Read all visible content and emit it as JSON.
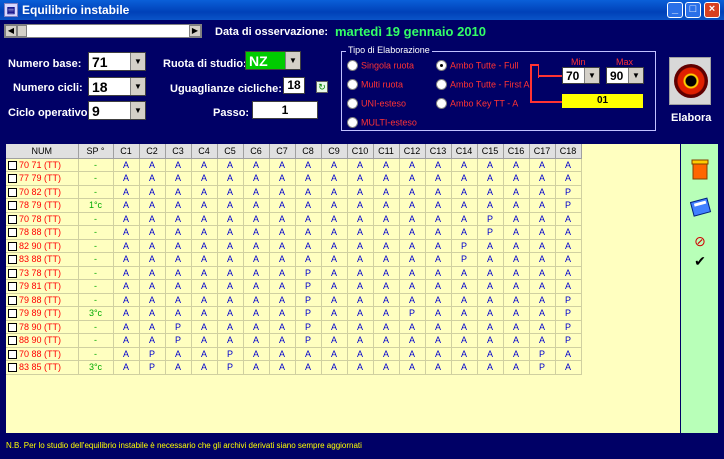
{
  "window": {
    "title": "Equilibrio instabile"
  },
  "header": {
    "obs_label": "Data di osservazione:",
    "obs_date": "martedì 19 gennaio 2010"
  },
  "form": {
    "numero_base_label": "Numero base:",
    "numero_base_value": "71",
    "numero_cicli_label": "Numero cicli:",
    "numero_cicli_value": "18",
    "ciclo_operativo_label": "Ciclo operativo:",
    "ciclo_operativo_value": "9",
    "ruota_label": "Ruota di studio:",
    "ruota_value": "NZ",
    "uguaglianze_label": "Uguaglianze cicliche:",
    "uguaglianze_value": "18",
    "passo_label": "Passo:",
    "passo_value": "1"
  },
  "elaborazione": {
    "title": "Tipo di Elaborazione",
    "options": [
      {
        "label": "Singola ruota",
        "selected": false
      },
      {
        "label": "Multi ruota",
        "selected": false
      },
      {
        "label": "UNI-esteso",
        "selected": false
      },
      {
        "label": "MULTI-esteso",
        "selected": false
      },
      {
        "label": "Ambo Tutte - Full",
        "selected": true
      },
      {
        "label": "Ambo Tutte - First A",
        "selected": false
      },
      {
        "label": "Ambo Key TT -  A",
        "selected": false
      }
    ],
    "min_label": "Min",
    "max_label": "Max",
    "min_value": "70",
    "max_value": "90",
    "result_value": "01"
  },
  "elabora": {
    "label": "Elabora"
  },
  "table": {
    "headers": [
      "NUM",
      "SP °",
      "C1",
      "C2",
      "C3",
      "C4",
      "C5",
      "C6",
      "C7",
      "C8",
      "C9",
      "C10",
      "C11",
      "C12",
      "C13",
      "C14",
      "C15",
      "C16",
      "C17",
      "C18"
    ],
    "rows": [
      [
        "70 71  (TT)",
        "-",
        "A",
        "A",
        "A",
        "A",
        "A",
        "A",
        "A",
        "A",
        "A",
        "A",
        "A",
        "A",
        "A",
        "A",
        "A",
        "A",
        "A",
        "A"
      ],
      [
        "77 79  (TT)",
        "-",
        "A",
        "A",
        "A",
        "A",
        "A",
        "A",
        "A",
        "A",
        "A",
        "A",
        "A",
        "A",
        "A",
        "A",
        "A",
        "A",
        "A",
        "A"
      ],
      [
        "70 82  (TT)",
        "-",
        "A",
        "A",
        "A",
        "A",
        "A",
        "A",
        "A",
        "A",
        "A",
        "A",
        "A",
        "A",
        "A",
        "A",
        "A",
        "A",
        "A",
        "P"
      ],
      [
        "78 79  (TT)",
        "1°c",
        "A",
        "A",
        "A",
        "A",
        "A",
        "A",
        "A",
        "A",
        "A",
        "A",
        "A",
        "A",
        "A",
        "A",
        "A",
        "A",
        "A",
        "P"
      ],
      [
        "70 78  (TT)",
        "-",
        "A",
        "A",
        "A",
        "A",
        "A",
        "A",
        "A",
        "A",
        "A",
        "A",
        "A",
        "A",
        "A",
        "A",
        "P",
        "A",
        "A",
        "A"
      ],
      [
        "78 88  (TT)",
        "-",
        "A",
        "A",
        "A",
        "A",
        "A",
        "A",
        "A",
        "A",
        "A",
        "A",
        "A",
        "A",
        "A",
        "A",
        "P",
        "A",
        "A",
        "A"
      ],
      [
        "82 90  (TT)",
        "-",
        "A",
        "A",
        "A",
        "A",
        "A",
        "A",
        "A",
        "A",
        "A",
        "A",
        "A",
        "A",
        "A",
        "P",
        "A",
        "A",
        "A",
        "A"
      ],
      [
        "83 88  (TT)",
        "-",
        "A",
        "A",
        "A",
        "A",
        "A",
        "A",
        "A",
        "A",
        "A",
        "A",
        "A",
        "A",
        "A",
        "P",
        "A",
        "A",
        "A",
        "A"
      ],
      [
        "73 78  (TT)",
        "-",
        "A",
        "A",
        "A",
        "A",
        "A",
        "A",
        "A",
        "P",
        "A",
        "A",
        "A",
        "A",
        "A",
        "A",
        "A",
        "A",
        "A",
        "A"
      ],
      [
        "79 81  (TT)",
        "-",
        "A",
        "A",
        "A",
        "A",
        "A",
        "A",
        "A",
        "P",
        "A",
        "A",
        "A",
        "A",
        "A",
        "A",
        "A",
        "A",
        "A",
        "A"
      ],
      [
        "79 88  (TT)",
        "-",
        "A",
        "A",
        "A",
        "A",
        "A",
        "A",
        "A",
        "P",
        "A",
        "A",
        "A",
        "A",
        "A",
        "A",
        "A",
        "A",
        "A",
        "P"
      ],
      [
        "79 89  (TT)",
        "3°c",
        "A",
        "A",
        "A",
        "A",
        "A",
        "A",
        "A",
        "P",
        "A",
        "A",
        "A",
        "P",
        "A",
        "A",
        "A",
        "A",
        "A",
        "P"
      ],
      [
        "78 90  (TT)",
        "-",
        "A",
        "A",
        "P",
        "A",
        "A",
        "A",
        "A",
        "P",
        "A",
        "A",
        "A",
        "A",
        "A",
        "A",
        "A",
        "A",
        "A",
        "P"
      ],
      [
        "88 90  (TT)",
        "-",
        "A",
        "A",
        "P",
        "A",
        "A",
        "A",
        "A",
        "P",
        "A",
        "A",
        "A",
        "A",
        "A",
        "A",
        "A",
        "A",
        "A",
        "P"
      ],
      [
        "70 88  (TT)",
        "-",
        "A",
        "P",
        "A",
        "A",
        "P",
        "A",
        "A",
        "A",
        "A",
        "A",
        "A",
        "A",
        "A",
        "A",
        "A",
        "A",
        "P",
        "A"
      ],
      [
        "83 85  (TT)",
        "3°c",
        "A",
        "P",
        "A",
        "A",
        "P",
        "A",
        "A",
        "A",
        "A",
        "A",
        "A",
        "A",
        "A",
        "A",
        "A",
        "A",
        "P",
        "A"
      ]
    ]
  },
  "footer": {
    "note": "N.B. Per lo studio dell'equilibrio instabile è necessario che gli archivi derivati siano sempre aggiornati"
  }
}
